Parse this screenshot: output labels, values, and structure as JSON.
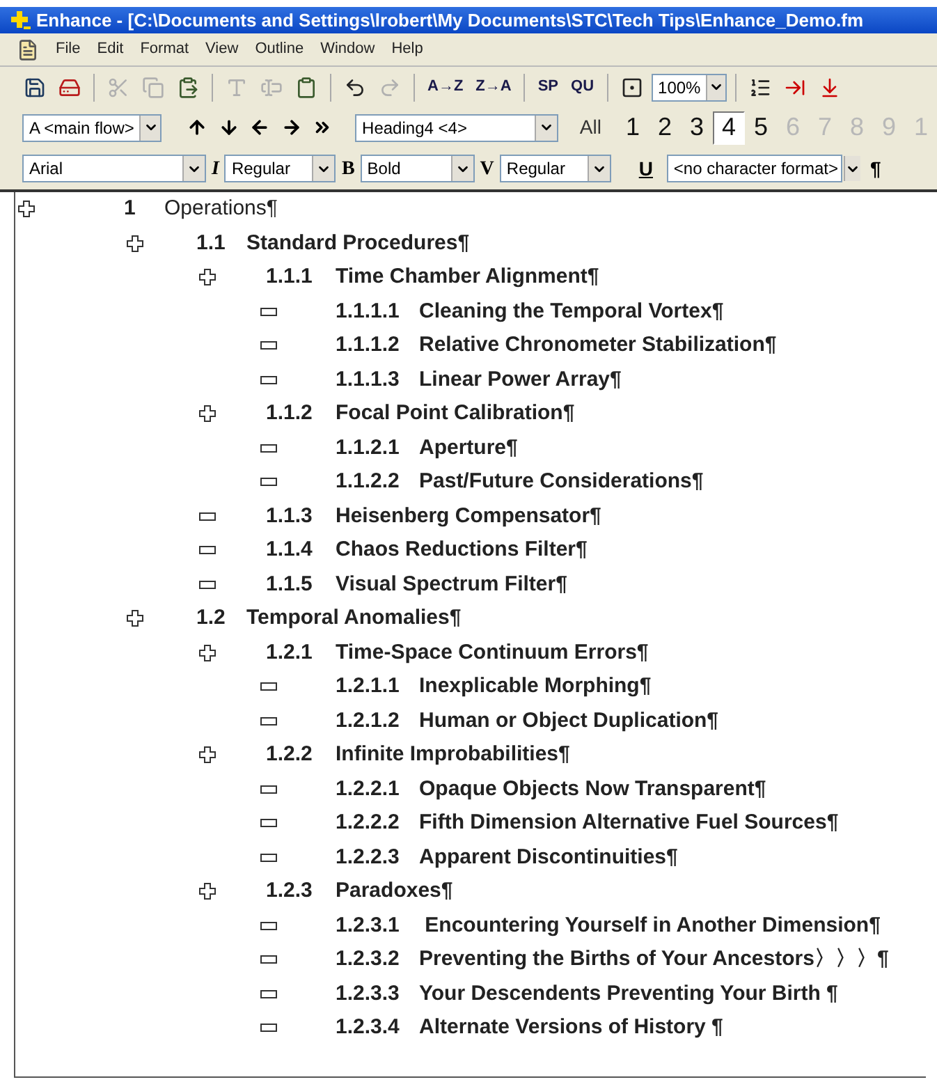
{
  "window": {
    "title": "Enhance - [C:\\Documents and Settings\\lrobert\\My Documents\\STC\\Tech Tips\\Enhance_Demo.fm"
  },
  "menu": [
    "File",
    "Edit",
    "Format",
    "View",
    "Outline",
    "Window",
    "Help"
  ],
  "toolbar_1": [
    {
      "kind": "icon",
      "disabled": false
    },
    {
      "kind": "icon",
      "disabled": false
    },
    {
      "kind": "sep"
    },
    {
      "kind": "icon",
      "disabled": true
    },
    {
      "kind": "icon",
      "disabled": true
    },
    {
      "kind": "icon",
      "disabled": false
    },
    {
      "kind": "sep"
    },
    {
      "kind": "icon",
      "disabled": true
    },
    {
      "kind": "icon",
      "disabled": true
    },
    {
      "kind": "icon",
      "disabled": false
    },
    {
      "kind": "sep"
    },
    {
      "kind": "icon",
      "disabled": false
    },
    {
      "kind": "icon",
      "disabled": true
    },
    {
      "kind": "sep"
    },
    {
      "kind": "text",
      "label": "A→Z",
      "disabled": false
    },
    {
      "kind": "text",
      "label": "Z→A",
      "disabled": false
    },
    {
      "kind": "sep"
    },
    {
      "kind": "text",
      "label": "SP",
      "disabled": false
    },
    {
      "kind": "text",
      "label": "QU",
      "disabled": false
    },
    {
      "kind": "sep"
    },
    {
      "kind": "icon",
      "disabled": false
    },
    {
      "kind": "dropdown",
      "value": "100%"
    },
    {
      "kind": "sep"
    },
    {
      "kind": "icon",
      "disabled": false
    },
    {
      "kind": "icon",
      "disabled": false
    },
    {
      "kind": "icon",
      "disabled": false
    }
  ],
  "toolbar_2": {
    "flow": "A <main flow>",
    "paragraph_tag": "Heading4  <4>",
    "all_button": "All",
    "levels": [
      {
        "label": "1",
        "selected": false,
        "disabled": false
      },
      {
        "label": "2",
        "selected": false,
        "disabled": false
      },
      {
        "label": "3",
        "selected": false,
        "disabled": false
      },
      {
        "label": "4",
        "selected": true,
        "disabled": false
      },
      {
        "label": "5",
        "selected": false,
        "disabled": false
      },
      {
        "label": "6",
        "selected": false,
        "disabled": true
      },
      {
        "label": "7",
        "selected": false,
        "disabled": true
      },
      {
        "label": "8",
        "selected": false,
        "disabled": true
      },
      {
        "label": "9",
        "selected": false,
        "disabled": true
      },
      {
        "label": "1",
        "selected": false,
        "disabled": true
      }
    ]
  },
  "toolbar_3": {
    "font": "Arial",
    "italic_glyph": "I",
    "italic": "Regular",
    "bold_glyph": "B",
    "bold": "Bold",
    "variation_glyph": "V",
    "variation": "Regular",
    "underline_button": "U",
    "character_format": "<no character format>",
    "pilcrow_button": "¶"
  },
  "outline": [
    {
      "number": "1",
      "title": "Operations¶",
      "children": [
        {
          "number": "1.1",
          "title": "Standard Procedures¶",
          "children": [
            {
              "number": "1.1.1",
              "title": "Time Chamber Alignment¶",
              "children": [
                {
                  "number": "1.1.1.1",
                  "title": "Cleaning the Temporal Vortex¶"
                },
                {
                  "number": "1.1.1.2",
                  "title": "Relative Chronometer Stabilization¶"
                },
                {
                  "number": "1.1.1.3",
                  "title": "Linear Power Array¶"
                }
              ]
            },
            {
              "number": "1.1.2",
              "title": "Focal Point Calibration¶",
              "children": [
                {
                  "number": "1.1.2.1",
                  "title": "Aperture¶"
                },
                {
                  "number": "1.1.2.2",
                  "title": "Past/Future Considerations¶"
                }
              ]
            },
            {
              "number": "1.1.3",
              "title": "Heisenberg Compensator¶"
            },
            {
              "number": "1.1.4",
              "title": "Chaos Reductions Filter¶"
            },
            {
              "number": "1.1.5",
              "title": "Visual Spectrum Filter¶"
            }
          ]
        },
        {
          "number": "1.2",
          "title": "Temporal Anomalies¶",
          "children": [
            {
              "number": "1.2.1",
              "title": "Time-Space Continuum Errors¶",
              "children": [
                {
                  "number": "1.2.1.1",
                  "title": "Inexplicable Morphing¶"
                },
                {
                  "number": "1.2.1.2",
                  "title": "Human or Object Duplication¶"
                }
              ]
            },
            {
              "number": "1.2.2",
              "title": "Infinite Improbabilities¶",
              "children": [
                {
                  "number": "1.2.2.1",
                  "title": "Opaque Objects Now Transparent¶"
                },
                {
                  "number": "1.2.2.2",
                  "title": "Fifth Dimension Alternative Fuel Sources¶"
                },
                {
                  "number": "1.2.2.3",
                  "title": "Apparent Discontinuities¶"
                }
              ]
            },
            {
              "number": "1.2.3",
              "title": "Paradoxes¶",
              "children": [
                {
                  "number": "1.2.3.1",
                  "title": " Encountering Yourself in Another Dimension¶"
                },
                {
                  "number": "1.2.3.2",
                  "title": "Preventing the Births of Your Ancestors〉〉〉¶"
                },
                {
                  "number": "1.2.3.3",
                  "title": "Your Descendents Preventing Your Birth ¶"
                },
                {
                  "number": "1.2.3.4",
                  "title": "Alternate Versions of History ¶"
                }
              ]
            }
          ]
        }
      ]
    }
  ]
}
